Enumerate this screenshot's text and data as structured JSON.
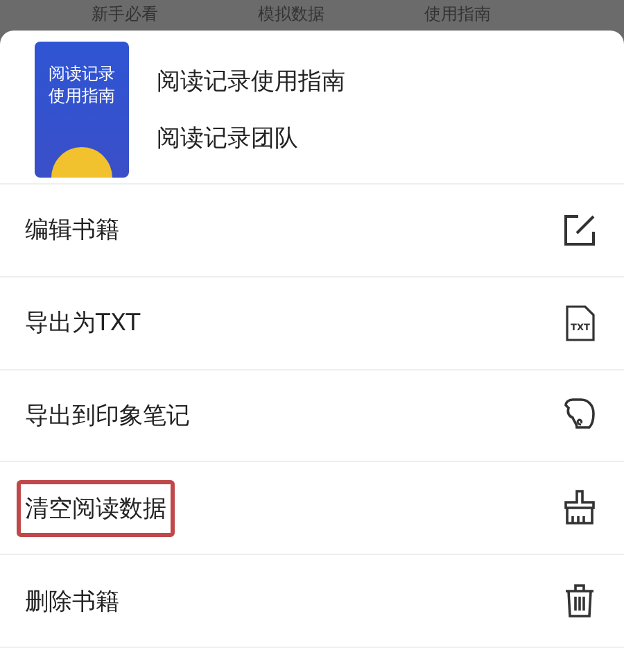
{
  "background_tabs": [
    "新手必看",
    "模拟数据",
    "使用指南"
  ],
  "book": {
    "cover_title": "阅读记录使用指南",
    "title": "阅读记录使用指南",
    "author": "阅读记录团队"
  },
  "actions": [
    {
      "label": "编辑书籍",
      "kind": "edit",
      "highlighted": false
    },
    {
      "label": "导出为TXT",
      "kind": "txt",
      "icon_text": "TXT",
      "highlighted": false
    },
    {
      "label": "导出到印象笔记",
      "kind": "elephant",
      "highlighted": false
    },
    {
      "label": "清空阅读数据",
      "kind": "broom",
      "highlighted": true
    },
    {
      "label": "删除书籍",
      "kind": "trash",
      "highlighted": false
    }
  ]
}
